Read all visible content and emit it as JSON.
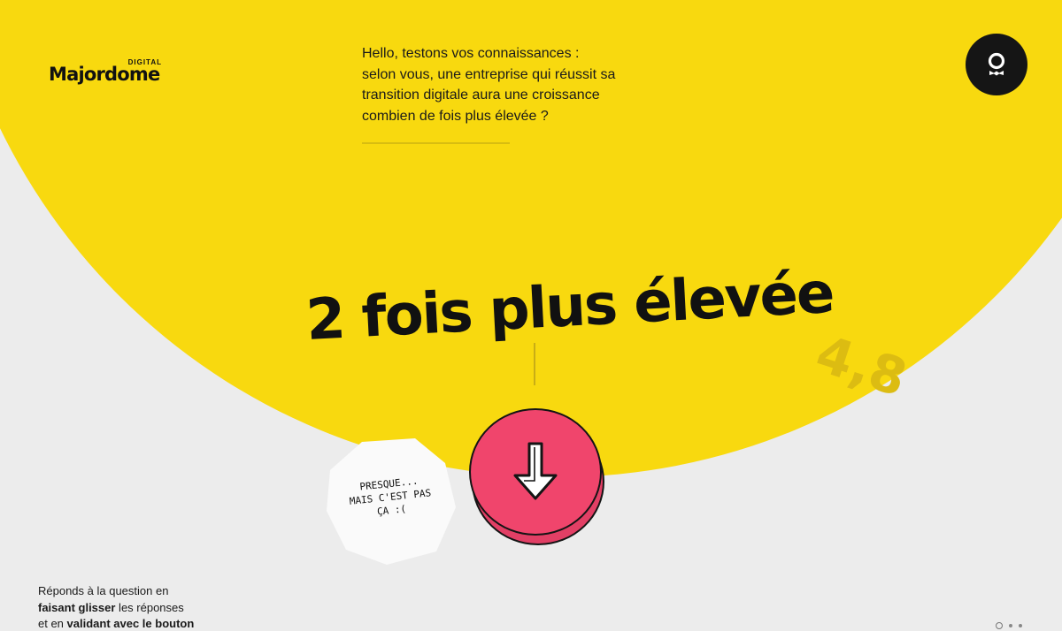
{
  "logo": {
    "word": "Majordome",
    "tag": "DIGITAL"
  },
  "question": {
    "lines": [
      "Hello, testons vos connaissances :",
      "selon vous, une entreprise qui réussit sa",
      "transition digitale aura une croissance",
      "combien de fois plus élevée ?"
    ]
  },
  "answer": {
    "current": "2 fois plus élevée",
    "next": "4,8"
  },
  "feedback": {
    "lines": [
      "PRESQUE...",
      "MAIS C'EST PAS",
      "ÇA :("
    ]
  },
  "instructions": {
    "line1": "Réponds à la question en",
    "line2_bold": "faisant glisser",
    "line2_rest": " les réponses",
    "line3_start": "et en ",
    "line3_bold": "validant avec le bouton"
  },
  "icons": {
    "profile": "profile-icon",
    "validate": "arrow-down-icon"
  },
  "colors": {
    "yellow": "#f8d90f",
    "pink": "#f0456c",
    "background": "#ececec",
    "dark": "#151515"
  },
  "pagination": {
    "total": 3,
    "active": 1
  }
}
